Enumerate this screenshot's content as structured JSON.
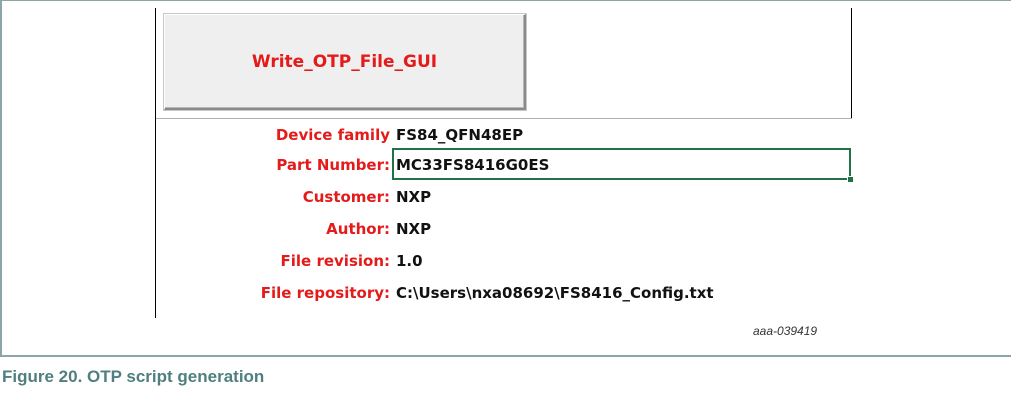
{
  "button": {
    "label": "Write_OTP_File_GUI"
  },
  "fields": [
    {
      "label": "Device family",
      "value": "FS84_QFN48EP"
    },
    {
      "label": "Part Number:",
      "value": "MC33FS8416G0ES"
    },
    {
      "label": "Customer:",
      "value": "NXP"
    },
    {
      "label": "Author:",
      "value": "NXP"
    },
    {
      "label": "File revision:",
      "value": "1.0"
    },
    {
      "label": "File repository:",
      "value": "C:\\Users\\nxa08692\\FS8416_Config.txt"
    }
  ],
  "figure_id": "aaa-039419",
  "caption": "Figure 20.  OTP script generation",
  "colors": {
    "label_red": "#e41b1b",
    "caption_teal": "#4f7f7f",
    "selection_green": "#217346"
  }
}
